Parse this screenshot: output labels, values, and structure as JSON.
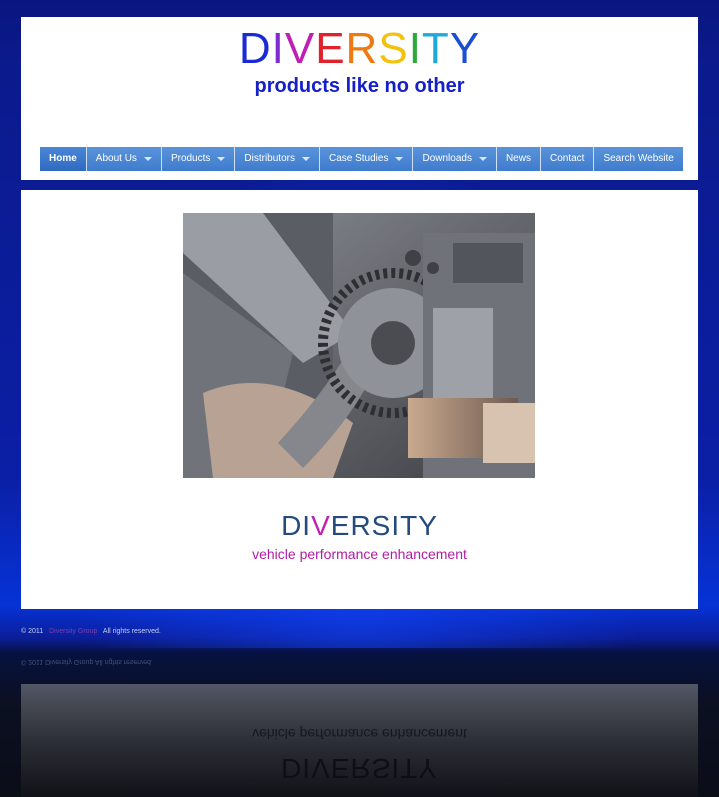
{
  "header": {
    "logo_letters": [
      {
        "char": "D",
        "color": "#1b2bd4"
      },
      {
        "char": "I",
        "color": "#7e2bd1"
      },
      {
        "char": "V",
        "color": "#c01fb5"
      },
      {
        "char": "E",
        "color": "#e0222a"
      },
      {
        "char": "R",
        "color": "#f07a12"
      },
      {
        "char": "S",
        "color": "#f2c20f"
      },
      {
        "char": "I",
        "color": "#2ea93b"
      },
      {
        "char": "T",
        "color": "#1fa9d8"
      },
      {
        "char": "Y",
        "color": "#1b4ed4"
      }
    ],
    "tagline": "products like no other"
  },
  "nav": {
    "items": [
      {
        "label": "Home",
        "dropdown": false,
        "active": true
      },
      {
        "label": "About Us",
        "dropdown": true,
        "active": false
      },
      {
        "label": "Products",
        "dropdown": true,
        "active": false
      },
      {
        "label": "Distributors",
        "dropdown": true,
        "active": false
      },
      {
        "label": "Case Studies",
        "dropdown": true,
        "active": false
      },
      {
        "label": "Downloads",
        "dropdown": true,
        "active": false
      },
      {
        "label": "News",
        "dropdown": false,
        "active": false
      },
      {
        "label": "Contact",
        "dropdown": false,
        "active": false
      },
      {
        "label": "Search Website",
        "dropdown": false,
        "active": false
      }
    ]
  },
  "main": {
    "brand_prefix": "DI",
    "brand_v": "V",
    "brand_suffix": "ERSITY",
    "subtitle": "vehicle performance enhancement"
  },
  "footer": {
    "copyright": "© 2011",
    "company_link": "Diversity Group",
    "rights": "All rights reserved."
  },
  "colors": {
    "accent_blue": "#1520c8",
    "nav_blue": "#3d7fd1",
    "brand_navy": "#244a7e",
    "brand_magenta": "#c01fb5"
  }
}
